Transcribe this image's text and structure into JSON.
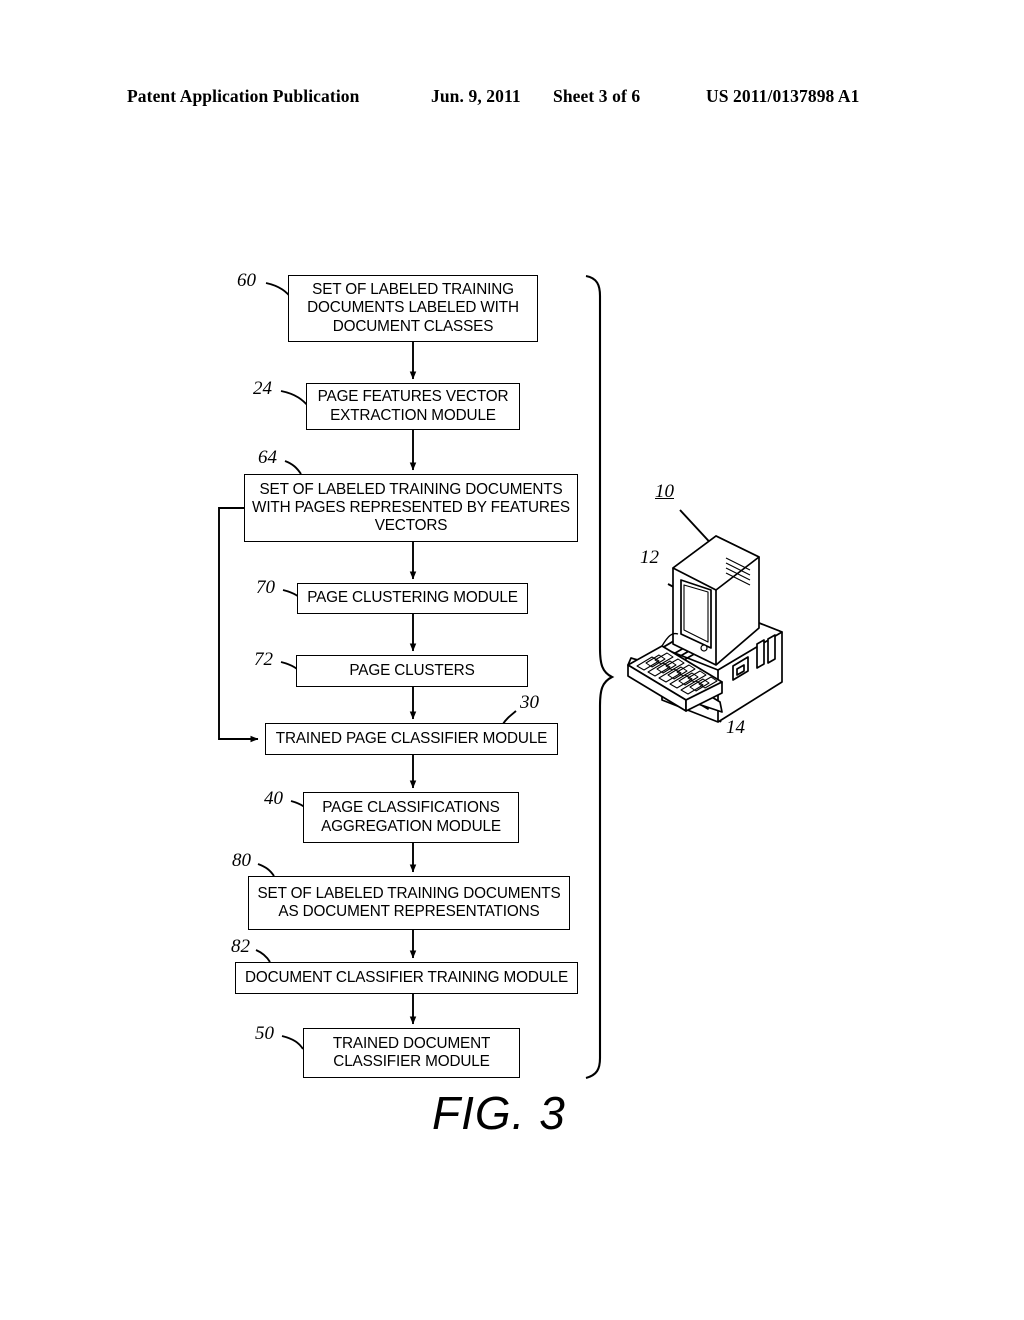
{
  "header": {
    "publication": "Patent Application Publication",
    "date": "Jun. 9, 2011",
    "sheet": "Sheet 3 of 6",
    "patent_number": "US 2011/0137898 A1"
  },
  "figure": {
    "caption": "FIG. 3",
    "line_color": "#000000",
    "background": "#ffffff"
  },
  "flowchart": {
    "boxes": [
      {
        "ref": "60",
        "label": "SET OF LABELED TRAINING DOCUMENTS LABELED WITH DOCUMENT CLASSES"
      },
      {
        "ref": "24",
        "label": "PAGE FEATURES VECTOR EXTRACTION MODULE"
      },
      {
        "ref": "64",
        "label": "SET OF LABELED TRAINING DOCUMENTS WITH PAGES REPRESENTED BY FEATURES VECTORS"
      },
      {
        "ref": "70",
        "label": "PAGE CLUSTERING MODULE"
      },
      {
        "ref": "72",
        "label": "PAGE CLUSTERS"
      },
      {
        "ref": "30",
        "label": "TRAINED PAGE CLASSIFIER MODULE"
      },
      {
        "ref": "40",
        "label": "PAGE CLASSIFICATIONS AGGREGATION MODULE"
      },
      {
        "ref": "80",
        "label": "SET OF LABELED TRAINING DOCUMENTS AS DOCUMENT REPRESENTATIONS"
      },
      {
        "ref": "82",
        "label": "DOCUMENT CLASSIFIER TRAINING MODULE"
      },
      {
        "ref": "50",
        "label": "TRAINED DOCUMENT CLASSIFIER MODULE"
      }
    ]
  },
  "computer_system": {
    "ref_system": "10",
    "ref_monitor": "12",
    "ref_keyboard": "14"
  }
}
